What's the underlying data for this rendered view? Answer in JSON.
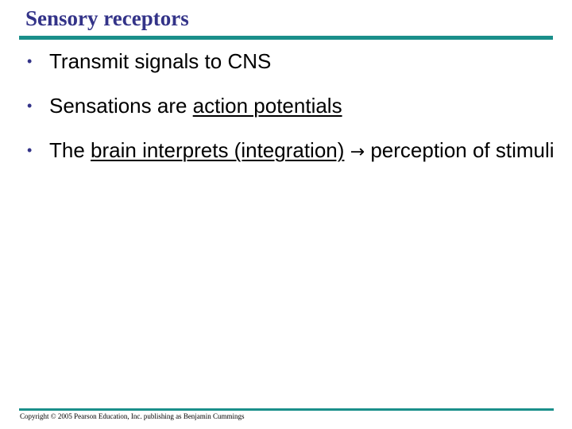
{
  "slide": {
    "title": "Sensory receptors",
    "accent_color": "#1a8f8a",
    "title_color": "#333388",
    "bullets": [
      {
        "segments": [
          {
            "text": "Transmit signals to CNS",
            "underline": false
          }
        ]
      },
      {
        "segments": [
          {
            "text": "Sensations are ",
            "underline": false
          },
          {
            "text": "action potentials",
            "underline": true
          }
        ]
      },
      {
        "segments": [
          {
            "text": "The ",
            "underline": false
          },
          {
            "text": "brain interprets (integration)",
            "underline": true
          },
          {
            "text": " ",
            "underline": false
          },
          {
            "text": "→",
            "underline": false,
            "arrow": true
          },
          {
            "text": " perception of stimuli",
            "underline": false
          }
        ]
      }
    ],
    "bullet_glyph": "•",
    "footer": "Copyright © 2005 Pearson Education, Inc. publishing as Benjamin Cummings"
  }
}
